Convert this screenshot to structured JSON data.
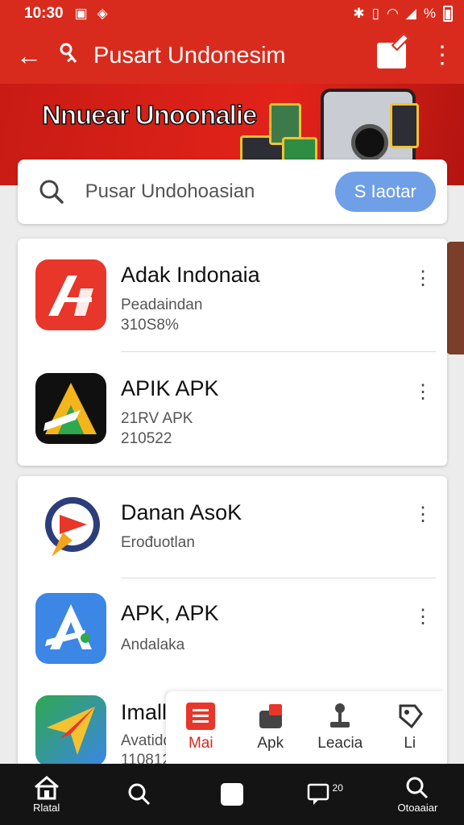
{
  "status_bar": {
    "time": "10:30",
    "battery": "%"
  },
  "app_bar": {
    "title": "Pusart Undonesim"
  },
  "banner": {
    "text": "Nnuear Unoonalie"
  },
  "search": {
    "placeholder": "Pusar Undohoasian",
    "button_label": "S Iaotar"
  },
  "apps": [
    {
      "name": "Adak Indonaia",
      "line1": "Peadaindan",
      "line2": "310S8%"
    },
    {
      "name": "APIK APK",
      "line1": "21RV APK",
      "line2": "210522"
    },
    {
      "name": "Danan AsoK",
      "line1": "Erođuotlan",
      "line2": ""
    },
    {
      "name": "APK, APK",
      "line1": "Andalaka",
      "line2": ""
    },
    {
      "name": "Imall APK",
      "line1": "Avatidda",
      "line2": "110812"
    }
  ],
  "nav_strip": [
    {
      "label": "Mai",
      "icon": "list-icon",
      "active": true
    },
    {
      "label": "Apk",
      "icon": "store-icon",
      "active": false
    },
    {
      "label": "Leacia",
      "icon": "joystick-icon",
      "active": false
    },
    {
      "label": "Li",
      "icon": "tag-icon",
      "active": false
    }
  ],
  "bottom_nav": [
    {
      "label": "Rlatal",
      "icon": "home-icon"
    },
    {
      "label": "",
      "icon": "search-icon"
    },
    {
      "label": "",
      "icon": "home-button-icon"
    },
    {
      "label": "20",
      "icon": "chat-icon"
    },
    {
      "label": "Otoaaiar",
      "icon": "search-icon"
    }
  ]
}
